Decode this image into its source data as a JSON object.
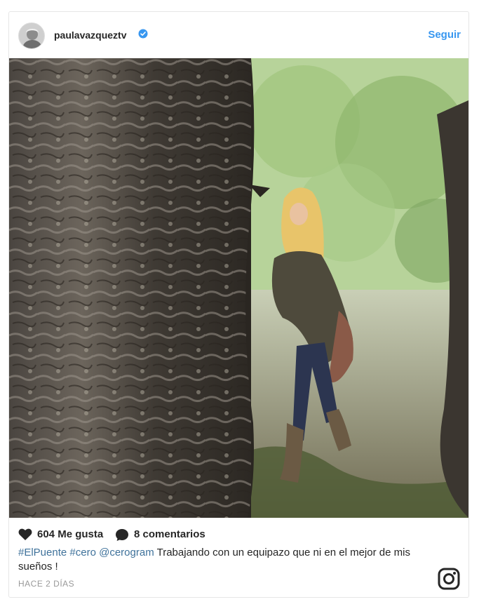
{
  "post": {
    "username": "paulavazqueztv",
    "follow_label": "Seguir",
    "likes_label": "604 Me gusta",
    "comments_label": "8 comentarios",
    "caption": {
      "tag1": "#ElPuente",
      "tag2": "#cero",
      "mention": "@cerogram",
      "text": "Trabajando con un equipazo que ni en el mejor de mis sueños !"
    },
    "time": "HACE 2 DÍAS"
  },
  "colors": {
    "accent": "#3897f0",
    "hashtag": "#3f729b",
    "muted": "#999999"
  },
  "icons": [
    "verified-badge-icon",
    "heart-icon",
    "comment-bubble-icon",
    "instagram-logo-icon"
  ]
}
